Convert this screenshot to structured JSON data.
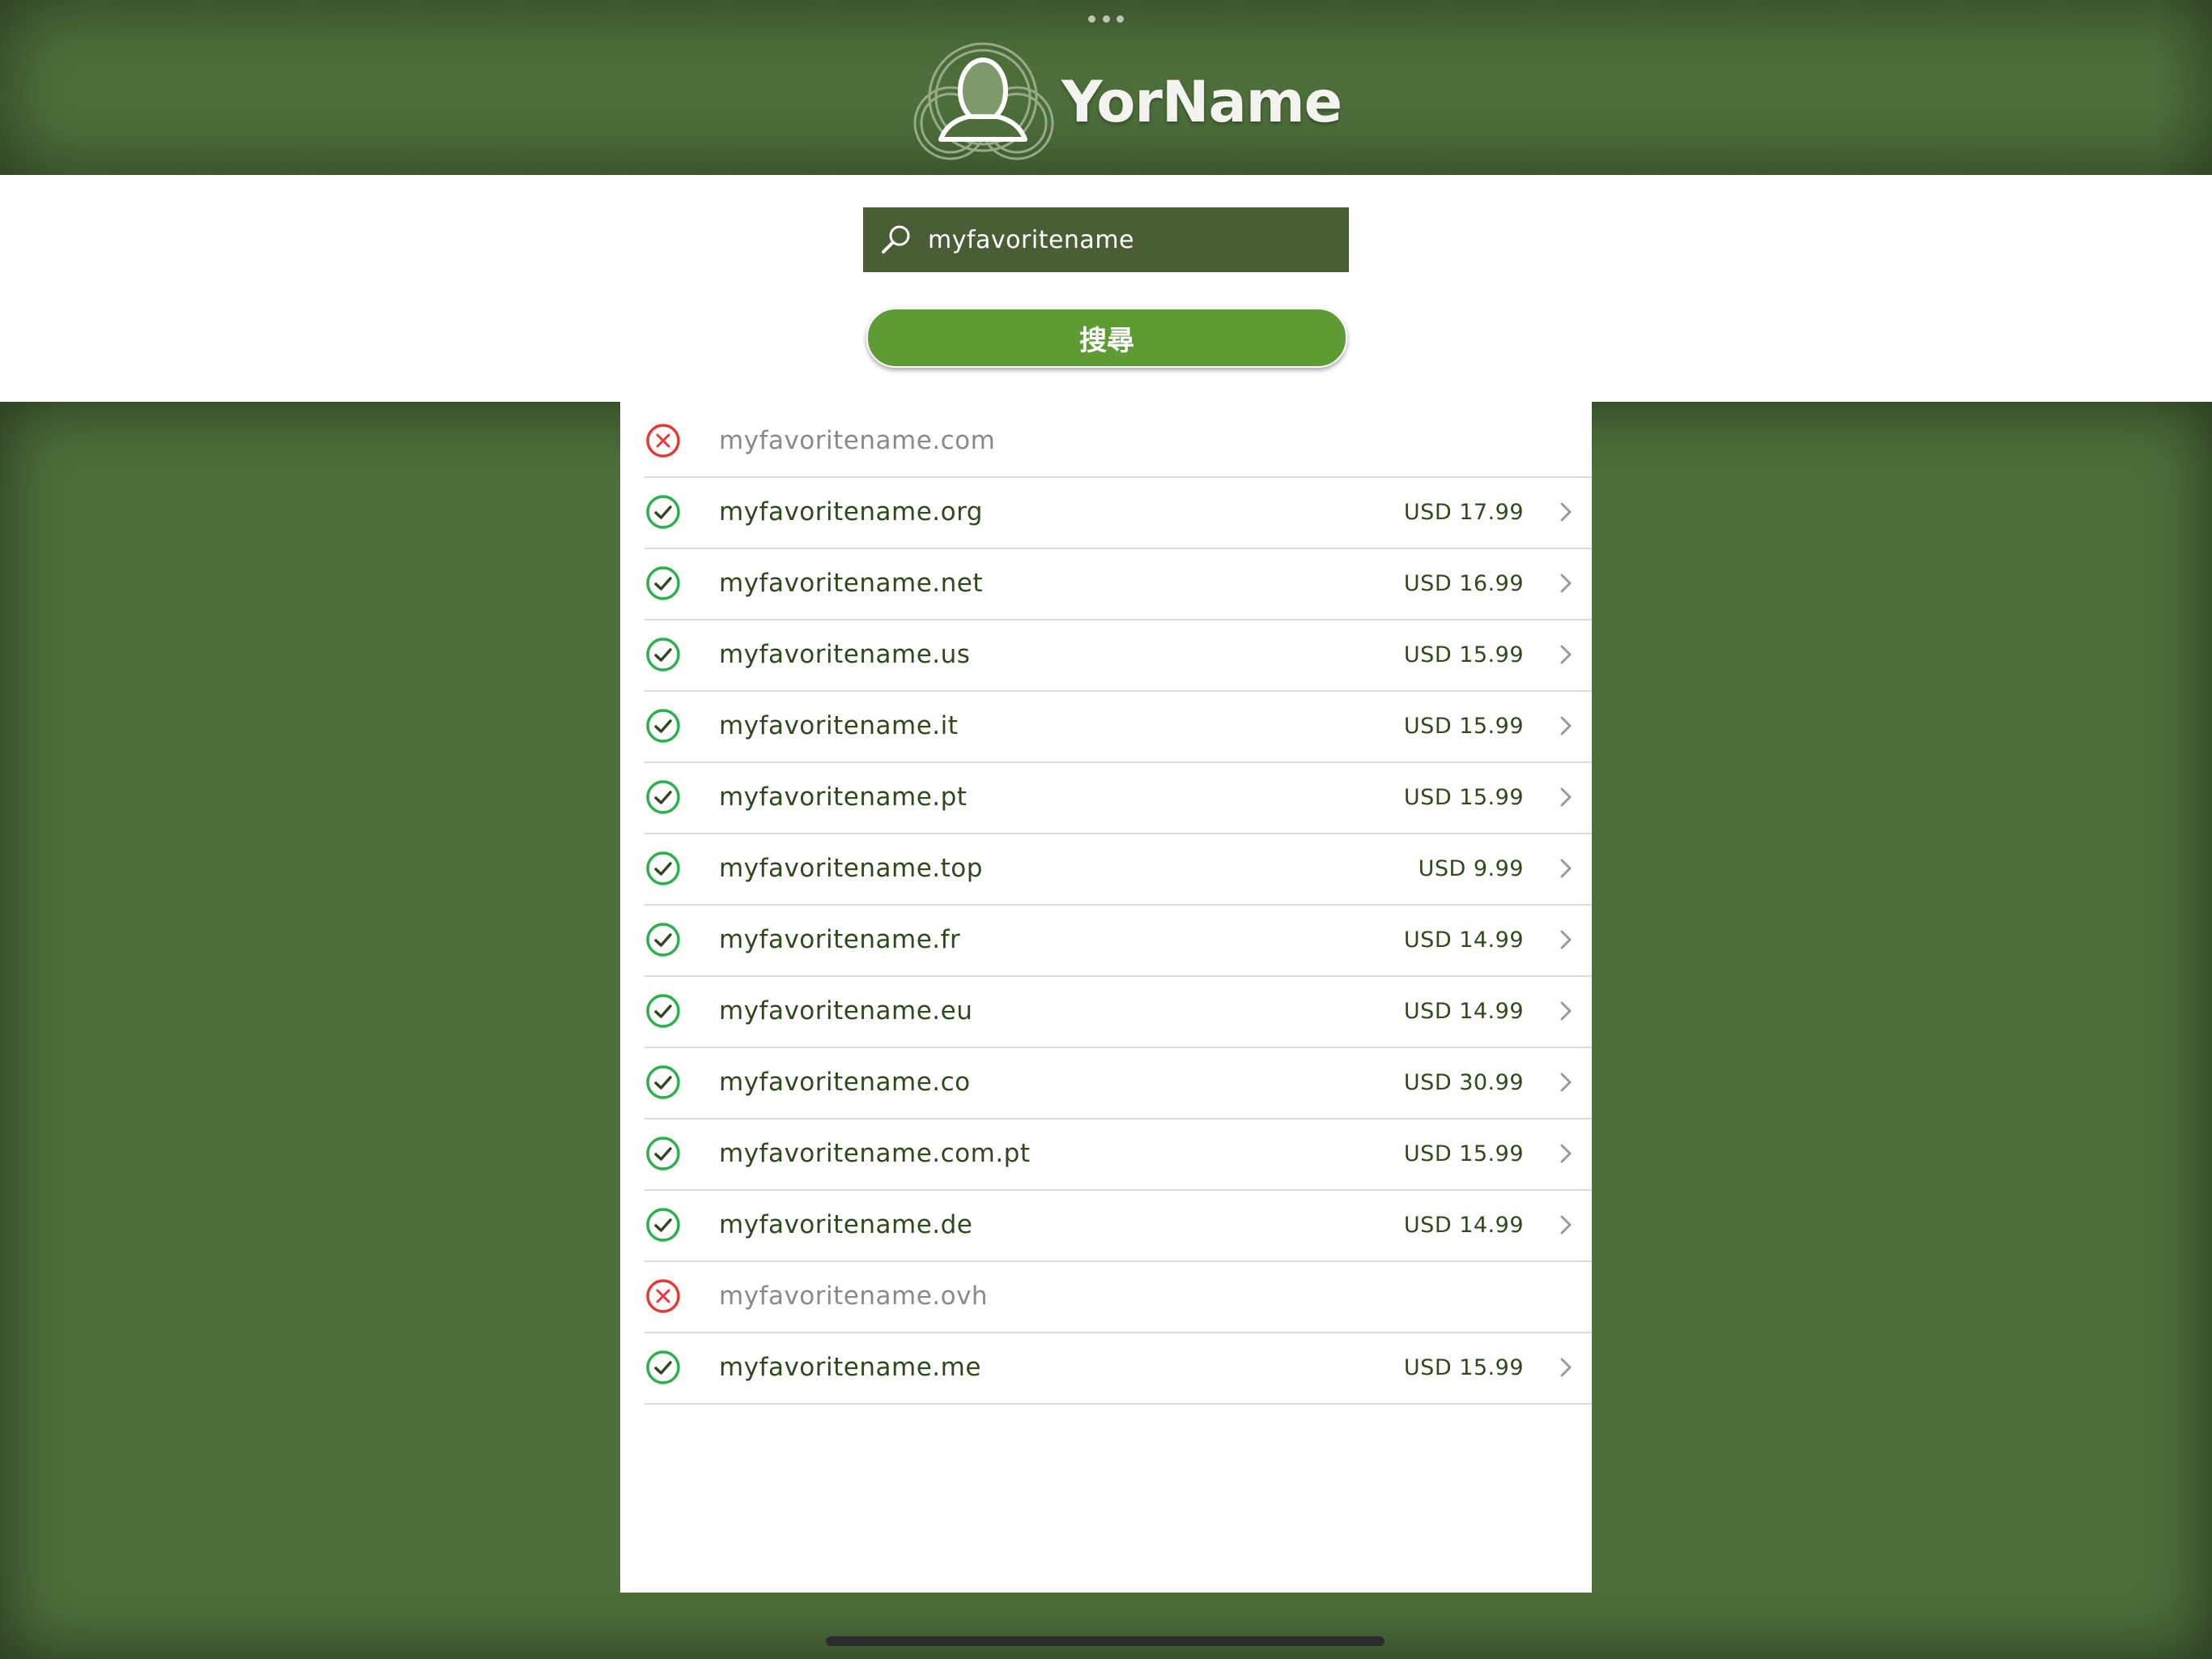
{
  "app": {
    "title": "YorName",
    "accent_color": "#5e9b34",
    "header_color": "#4e6f3b"
  },
  "search": {
    "value": "myfavoritename",
    "button_label": "搜尋"
  },
  "results": [
    {
      "domain": "myfavoritename.com",
      "available": false,
      "price": ""
    },
    {
      "domain": "myfavoritename.org",
      "available": true,
      "price": "USD 17.99"
    },
    {
      "domain": "myfavoritename.net",
      "available": true,
      "price": "USD 16.99"
    },
    {
      "domain": "myfavoritename.us",
      "available": true,
      "price": "USD 15.99"
    },
    {
      "domain": "myfavoritename.it",
      "available": true,
      "price": "USD 15.99"
    },
    {
      "domain": "myfavoritename.pt",
      "available": true,
      "price": "USD 15.99"
    },
    {
      "domain": "myfavoritename.top",
      "available": true,
      "price": "USD 9.99"
    },
    {
      "domain": "myfavoritename.fr",
      "available": true,
      "price": "USD 14.99"
    },
    {
      "domain": "myfavoritename.eu",
      "available": true,
      "price": "USD 14.99"
    },
    {
      "domain": "myfavoritename.co",
      "available": true,
      "price": "USD 30.99"
    },
    {
      "domain": "myfavoritename.com.pt",
      "available": true,
      "price": "USD 15.99"
    },
    {
      "domain": "myfavoritename.de",
      "available": true,
      "price": "USD 14.99"
    },
    {
      "domain": "myfavoritename.ovh",
      "available": false,
      "price": ""
    },
    {
      "domain": "myfavoritename.me",
      "available": true,
      "price": "USD 15.99"
    }
  ],
  "icons": {
    "available": "check-circle-icon",
    "unavailable": "x-circle-icon",
    "search": "magnifier-icon",
    "row_action": "chevron-right-icon",
    "logo": "person-silhouette-logo-icon"
  }
}
